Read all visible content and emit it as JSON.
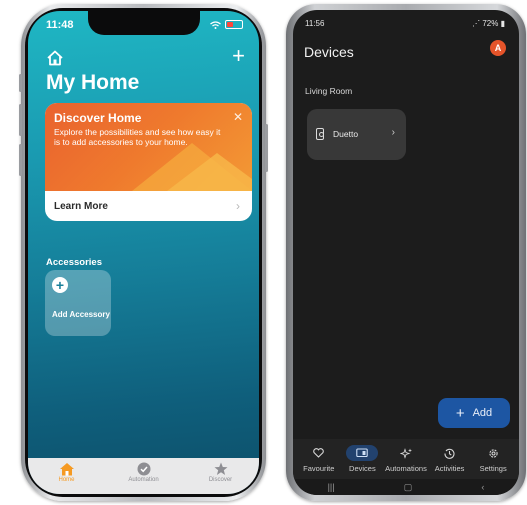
{
  "iphone": {
    "status": {
      "time": "11:48"
    },
    "header": {
      "title": "My Home"
    },
    "discover_card": {
      "title": "Discover Home",
      "body": "Explore the possibilities and see how easy it is to add accessories to your home.",
      "action": "Learn More"
    },
    "accessories": {
      "section_label": "Accessories",
      "add_tile_label": "Add Accessory"
    },
    "tabs": [
      {
        "label": "Home",
        "icon": "house-icon",
        "active": true
      },
      {
        "label": "Automation",
        "icon": "clock-check-icon",
        "active": false
      },
      {
        "label": "Discover",
        "icon": "star-icon",
        "active": false
      }
    ],
    "colors": {
      "accent": "#f59a23",
      "background_top": "#1fb7c4",
      "background_bottom": "#0c4e68"
    }
  },
  "android": {
    "status": {
      "time": "11:56",
      "battery": "72%"
    },
    "header": {
      "title": "Devices",
      "avatar_initial": "A"
    },
    "room": {
      "name": "Living Room"
    },
    "devices": [
      {
        "name": "Duetto",
        "icon": "speaker-icon"
      }
    ],
    "fab": {
      "label": "Add"
    },
    "nav": [
      {
        "label": "Favourite",
        "icon": "heart-icon",
        "active": false
      },
      {
        "label": "Devices",
        "icon": "devices-icon",
        "active": true
      },
      {
        "label": "Automations",
        "icon": "sparkle-icon",
        "active": false
      },
      {
        "label": "Activities",
        "icon": "history-icon",
        "active": false
      },
      {
        "label": "Settings",
        "icon": "gear-icon",
        "active": false
      }
    ],
    "colors": {
      "fab": "#1d56a3",
      "avatar": "#e5542a",
      "background": "#1c1c1c"
    }
  }
}
